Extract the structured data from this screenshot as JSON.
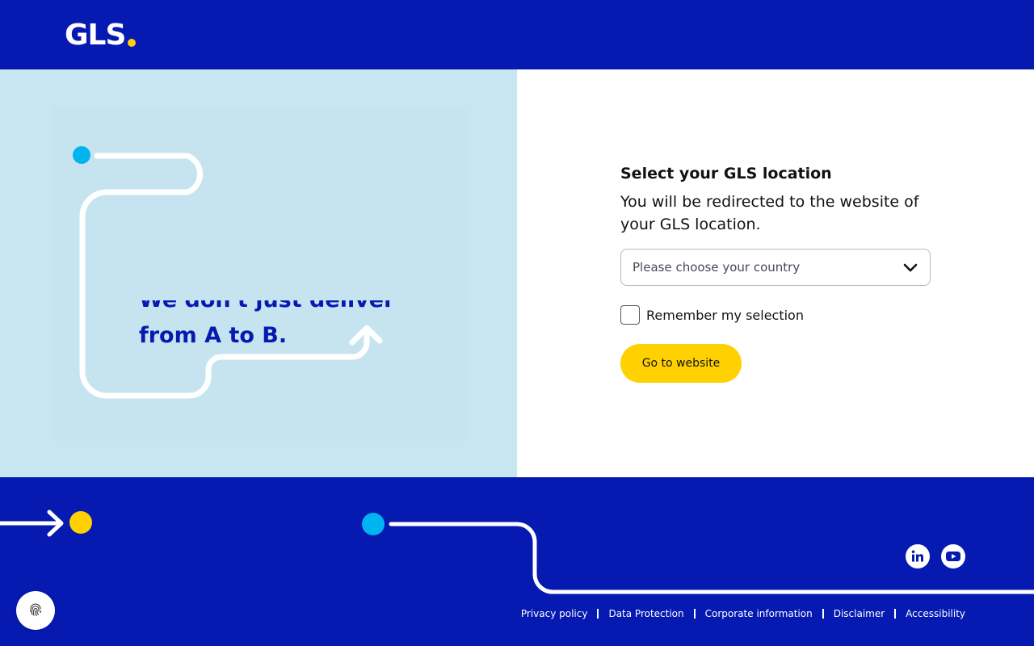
{
  "header": {
    "logo_text": "GLS",
    "colors": {
      "background": "#061ab1",
      "logo_dot": "#ffd100"
    }
  },
  "hero": {
    "headline_line1": "We don't just deliver",
    "headline_line2": "from A to B.",
    "colors": {
      "background": "#c8e6f2",
      "text": "#061ab1",
      "dot": "#00b4f0"
    }
  },
  "location": {
    "title": "Select your GLS location",
    "subtitle": "You will be redirected to the website of your GLS location.",
    "country_select": {
      "placeholder": "Please choose your country",
      "icon": "chevron-down-icon"
    },
    "remember_label": "Remember my selection",
    "remember_checked": false,
    "go_button": "Go to website",
    "colors": {
      "button": "#ffd100"
    }
  },
  "footer": {
    "social": [
      {
        "icon": "linkedin-icon"
      },
      {
        "icon": "youtube-icon"
      }
    ],
    "links": [
      "Privacy policy",
      "Data Protection",
      "Corporate information",
      "Disclaimer",
      "Accessibility"
    ],
    "colors": {
      "background": "#061ab1",
      "yellow_dot": "#ffd100",
      "blue_dot": "#00b4f0"
    }
  },
  "privacy_settings_button": {
    "icon": "fingerprint-icon"
  }
}
